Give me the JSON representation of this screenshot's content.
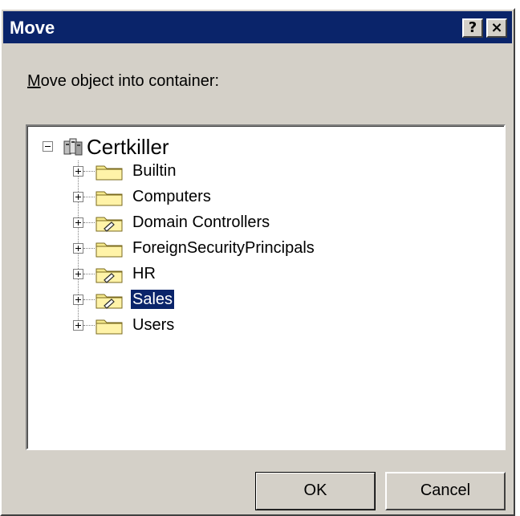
{
  "window": {
    "title": "Move",
    "help_label": "?",
    "close_label": "×"
  },
  "prompt": {
    "underlined": "M",
    "rest": "ove object into container:"
  },
  "tree": {
    "root": {
      "label": "Certkiller",
      "expanded": true,
      "icon": "domain-icon"
    },
    "items": [
      {
        "label": "Builtin",
        "icon": "folder-icon",
        "selected": false
      },
      {
        "label": "Computers",
        "icon": "folder-icon",
        "selected": false
      },
      {
        "label": "Domain Controllers",
        "icon": "ou-folder-icon",
        "selected": false
      },
      {
        "label": "ForeignSecurityPrincipals",
        "icon": "folder-icon",
        "selected": false
      },
      {
        "label": "HR",
        "icon": "ou-folder-icon",
        "selected": false
      },
      {
        "label": "Sales",
        "icon": "ou-folder-icon",
        "selected": true
      },
      {
        "label": "Users",
        "icon": "folder-icon",
        "selected": false
      }
    ]
  },
  "buttons": {
    "ok": "OK",
    "cancel": "Cancel"
  },
  "colors": {
    "title_bar": "#0a246a",
    "face": "#d4d0c8",
    "selection": "#0a246a",
    "folder": "#f5e98d"
  }
}
